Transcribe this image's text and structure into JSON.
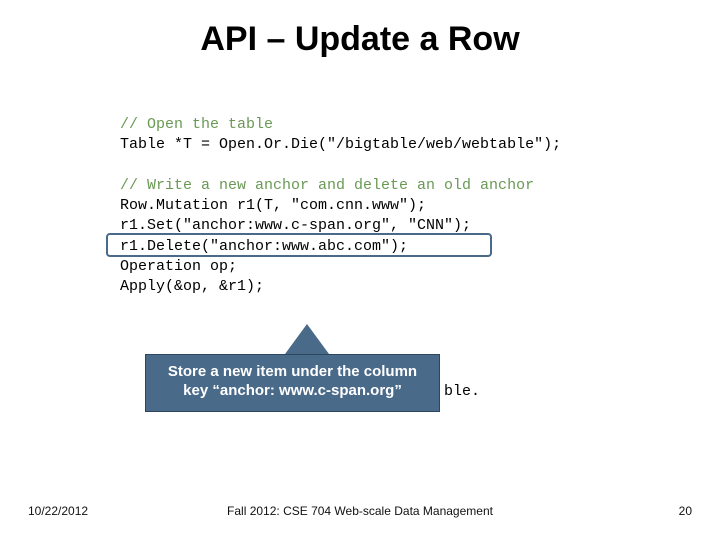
{
  "title": "API – Update a Row",
  "code": {
    "comment1": "// Open the table",
    "line2": "Table *T = Open.Or.Die(\"/bigtable/web/webtable\");",
    "comment2": "// Write a new anchor and delete an old anchor",
    "line4": "Row.Mutation r1(T, \"com.cnn.www\");",
    "line5": "r1.Set(\"anchor:www.c-span.org\", \"CNN\");",
    "line6": "r1.Delete(\"anchor:www.abc.com\");",
    "line7": "Operation op;",
    "line8": "Apply(&op, &r1);"
  },
  "callout": "Store a new item under the column key “anchor: www.c-span.org”",
  "bg_text": "ble.",
  "footer": {
    "date": "10/22/2012",
    "center": "Fall 2012: CSE 704 Web-scale Data Management",
    "page": "20"
  }
}
